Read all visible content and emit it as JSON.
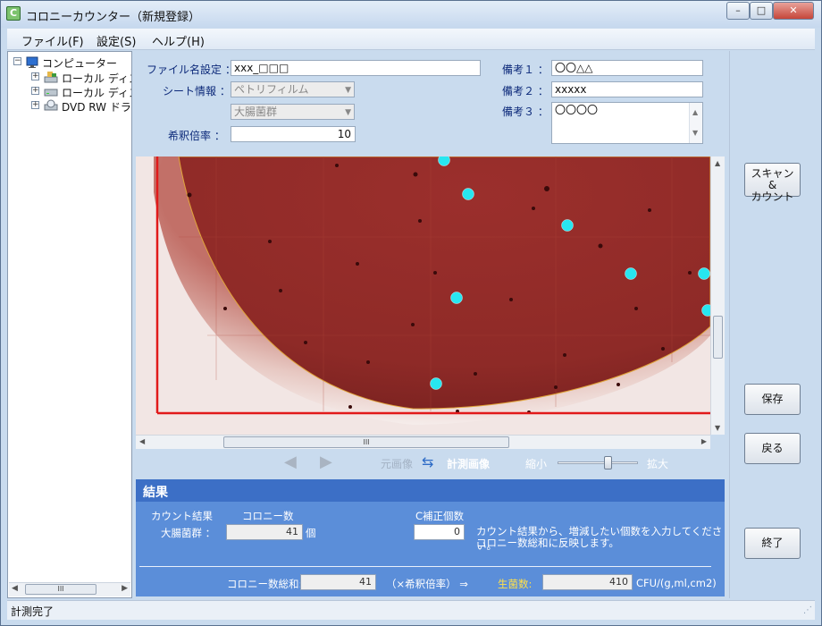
{
  "window": {
    "title": "コロニーカウンター（新規登録）"
  },
  "menu": [
    "ファイル(F)",
    "設定(S)",
    "ヘルプ(H)"
  ],
  "tree": {
    "root": "コンピューター",
    "children": [
      "ローカル ディスク",
      "ローカル ディスク",
      "DVD RW ドライブ"
    ],
    "scroll_thumb": "III"
  },
  "form": {
    "filename_label": "ファイル名設定 ：",
    "filename_value": "xxx_□□□",
    "sheet_label": "シート情報 ：",
    "sheet_value": "ペトリフィルム",
    "bacteria_value": "大腸菌群",
    "dilution_label": "希釈倍率 ：",
    "dilution_value": "10",
    "note1_label": "備考１ ：",
    "note1_value": "〇〇△△",
    "note2_label": "備考２ ：",
    "note2_value": "xxxxx",
    "note3_label": "備考３ ：",
    "note3_value": "〇〇〇〇"
  },
  "image_scroll_thumb": "III",
  "nav": {
    "original_label": "元画像",
    "measured_label": "計測画像",
    "shrink_label": "縮小",
    "zoom_label": "拡大",
    "zoom_level": 0.62
  },
  "result": {
    "title": "結果",
    "count_result_label": "カウント結果",
    "colony_count_label": "コロニー数",
    "bacteria_label": "大腸菌群 ：",
    "bacteria_count": "41",
    "unit_piece": "個",
    "c_correction_label": "C補正個数",
    "c_correction_value": "0",
    "hint_line1": "カウント結果から、増減したい個数を入力してください。",
    "hint_line2": "コロニー数総和に反映します。",
    "total_label": "コロニー数総和:",
    "total_value": "41",
    "dilution_note": "（×希釈倍率） ⇒",
    "viable_label": "生菌数:",
    "viable_value": "410",
    "viable_unit": "CFU/(g,ml,cm2)"
  },
  "buttons": {
    "scan": "スキャン &\nカウント",
    "save": "保存",
    "back": "戻る",
    "exit": "終了"
  },
  "status": "計測完了",
  "colors": {
    "petri_red": "#9c2e2b",
    "marker_cyan": "#28e6f0",
    "result_blue": "#5b8ed9",
    "bound_line": "#e11a1a"
  }
}
